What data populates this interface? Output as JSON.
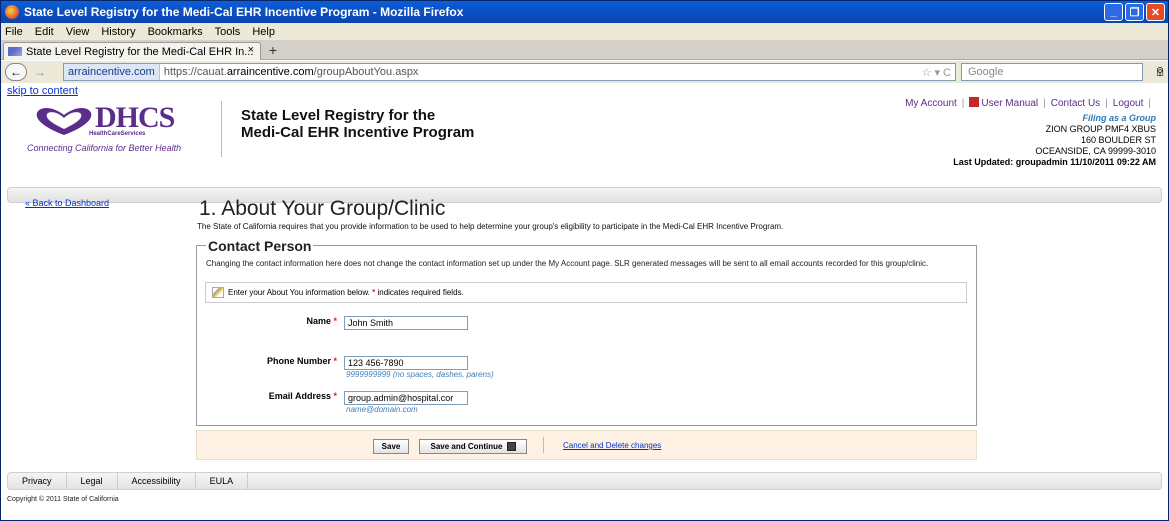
{
  "window": {
    "title": "State Level Registry for the Medi-Cal EHR Incentive Program - Mozilla Firefox"
  },
  "menu": [
    "File",
    "Edit",
    "View",
    "History",
    "Bookmarks",
    "Tools",
    "Help"
  ],
  "tab": {
    "label": "State Level Registry for the Medi-Cal EHR In...",
    "close": "×",
    "new": "+"
  },
  "nav": {
    "site": "arraincentive.com",
    "url_prefix": "https://cauat.",
    "url_domain": "arraincentive.com",
    "url_path": "/groupAboutYou.aspx",
    "search_placeholder": "Google"
  },
  "page": {
    "skip": "skip to content",
    "logo": {
      "main": "DHCS",
      "sub": "HealthCareServices",
      "tagline": "Connecting California for Better Health"
    },
    "title_line1": "State Level Registry for the",
    "title_line2": "Medi-Cal EHR Incentive Program",
    "links": {
      "my_account": "My Account",
      "user_manual": "User Manual",
      "contact_us": "Contact Us",
      "logout": "Logout"
    },
    "account": {
      "mode": "Filing as a Group",
      "name": "ZION GROUP PMF4 XBUS",
      "street": "160 BOULDER ST",
      "city": "OCEANSIDE, CA 99999-3010",
      "updated": "Last Updated: groupadmin 11/10/2011 09:22 AM"
    },
    "back": "« Back to Dashboard",
    "heading": "1. About Your Group/Clinic",
    "intro": "The State of California requires that you provide information to be used to help determine your group's eligibility to participate in the Medi-Cal EHR Incentive Program.",
    "section": "Contact Person",
    "note": "Changing the contact information here does not change the contact information set up under the My Account page. SLR generated messages will be sent to all email accounts recorded for this group/clinic.",
    "info_pre": "Enter your About You information below.",
    "info_post": "indicates required fields.",
    "req_mark": "*",
    "form": {
      "name_label": "Name",
      "name_value": "John Smith",
      "phone_label": "Phone Number",
      "phone_value": "123 456-7890",
      "phone_hint": "9999999999 (no spaces, dashes, parens)",
      "email_label": "Email Address",
      "email_value": "group.admin@hospital.cor",
      "email_hint": "name@domain.com"
    },
    "buttons": {
      "save": "Save",
      "save_continue": "Save and Continue",
      "cancel": "Cancel and Delete changes"
    },
    "footer": [
      "Privacy",
      "Legal",
      "Accessibility",
      "EULA"
    ],
    "copyright": "Copyright © 2011 State of California"
  }
}
